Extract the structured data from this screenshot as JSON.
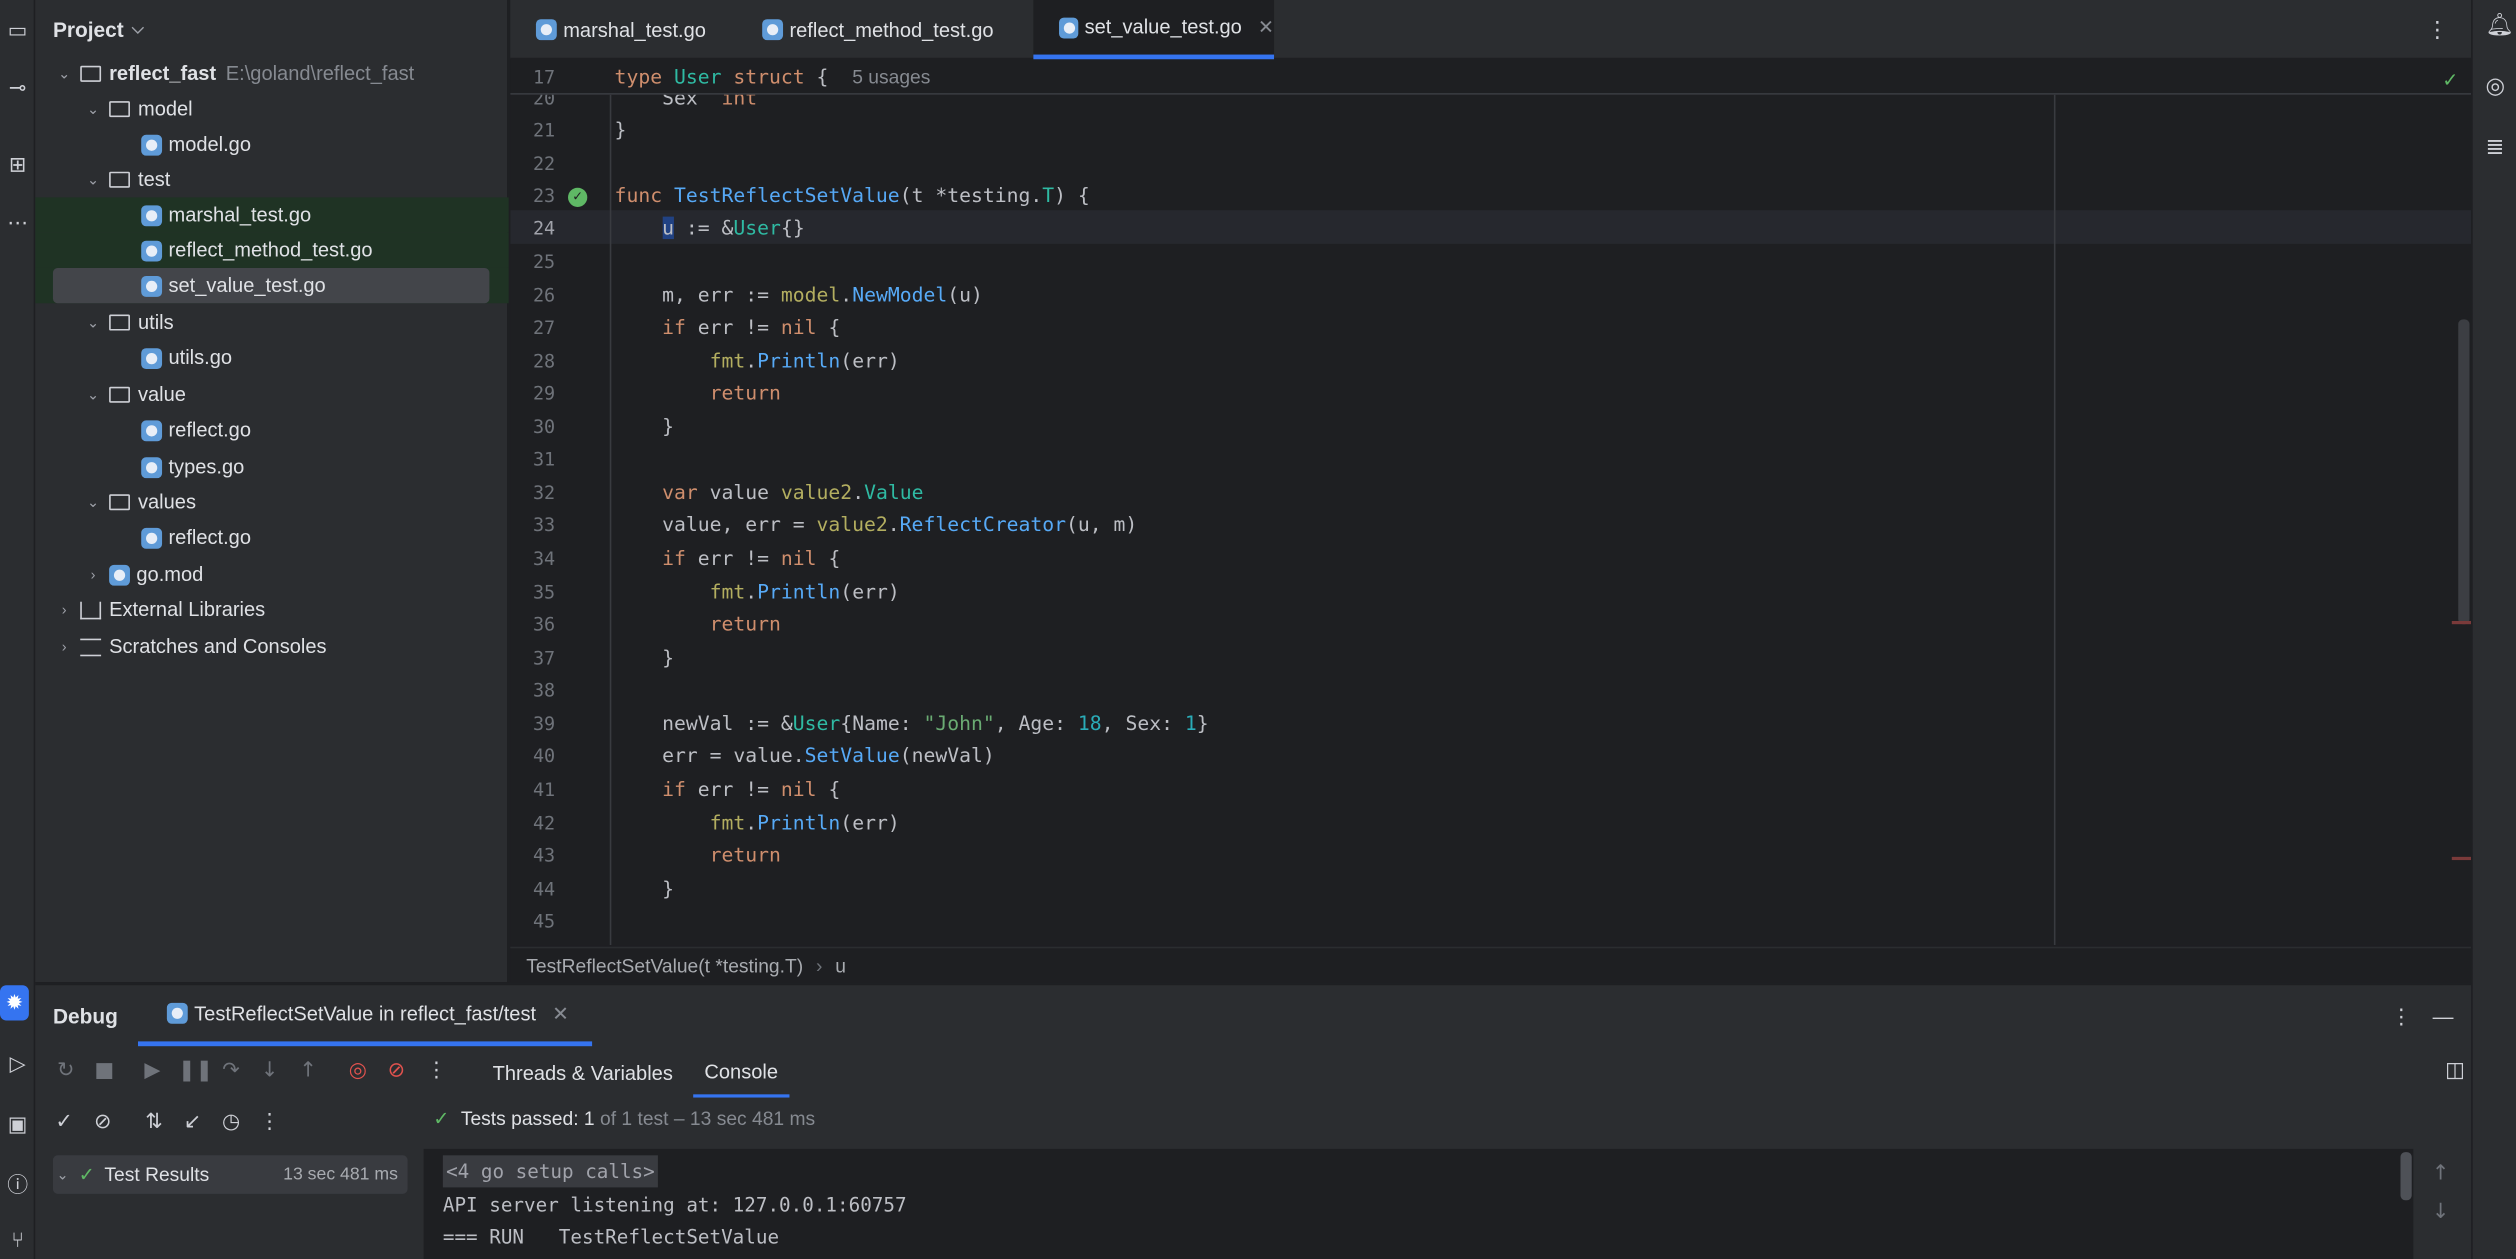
{
  "project": {
    "title": "Project",
    "tree": [
      {
        "label": "reflect_fast",
        "path": "E:\\goland\\reflect_fast"
      },
      {
        "label": "model"
      },
      {
        "label": "model.go"
      },
      {
        "label": "test"
      },
      {
        "label": "marshal_test.go"
      },
      {
        "label": "reflect_method_test.go"
      },
      {
        "label": "set_value_test.go"
      },
      {
        "label": "utils"
      },
      {
        "label": "utils.go"
      },
      {
        "label": "value"
      },
      {
        "label": "reflect.go"
      },
      {
        "label": "types.go"
      },
      {
        "label": "values"
      },
      {
        "label": "reflect.go"
      },
      {
        "label": "go.mod"
      },
      {
        "label": "External Libraries"
      },
      {
        "label": "Scratches and Consoles"
      }
    ]
  },
  "tabs": [
    {
      "label": "marshal_test.go"
    },
    {
      "label": "reflect_method_test.go"
    },
    {
      "label": "set_value_test.go",
      "active": true
    }
  ],
  "editor": {
    "sticky_line_no": "17",
    "sticky_hint": "5 usages",
    "line_numbers": [
      "20",
      "21",
      "22",
      "23",
      "24",
      "25",
      "26",
      "27",
      "28",
      "29",
      "30",
      "31",
      "32",
      "33",
      "34",
      "35",
      "36",
      "37",
      "38",
      "39",
      "40",
      "41",
      "42",
      "43",
      "44",
      "45"
    ],
    "current_line": "24"
  },
  "breadcrumb": {
    "function": "TestReflectSetValue(t *testing.T)",
    "symbol": "u"
  },
  "debug": {
    "title": "Debug",
    "session_tab": "TestReflectSetValue in reflect_fast/test",
    "subtabs": {
      "threads": "Threads & Variables",
      "console": "Console"
    },
    "status_prefix": "Tests passed:",
    "status_count": "1",
    "status_detail": "of 1 test – 13 sec 481 ms",
    "results_label": "Test Results",
    "results_time": "13 sec 481 ms",
    "console_lines": [
      "<4 go setup calls>",
      "API server listening at: 127.0.0.1:60757",
      "=== RUN   TestReflectSetValue"
    ]
  },
  "colors": {
    "accent": "#3574f0",
    "success": "#5fb865",
    "keyword": "#cf8e6d",
    "function": "#56a8f5",
    "type": "#2fbaa3",
    "string": "#6aab73",
    "number": "#2aacb8"
  }
}
